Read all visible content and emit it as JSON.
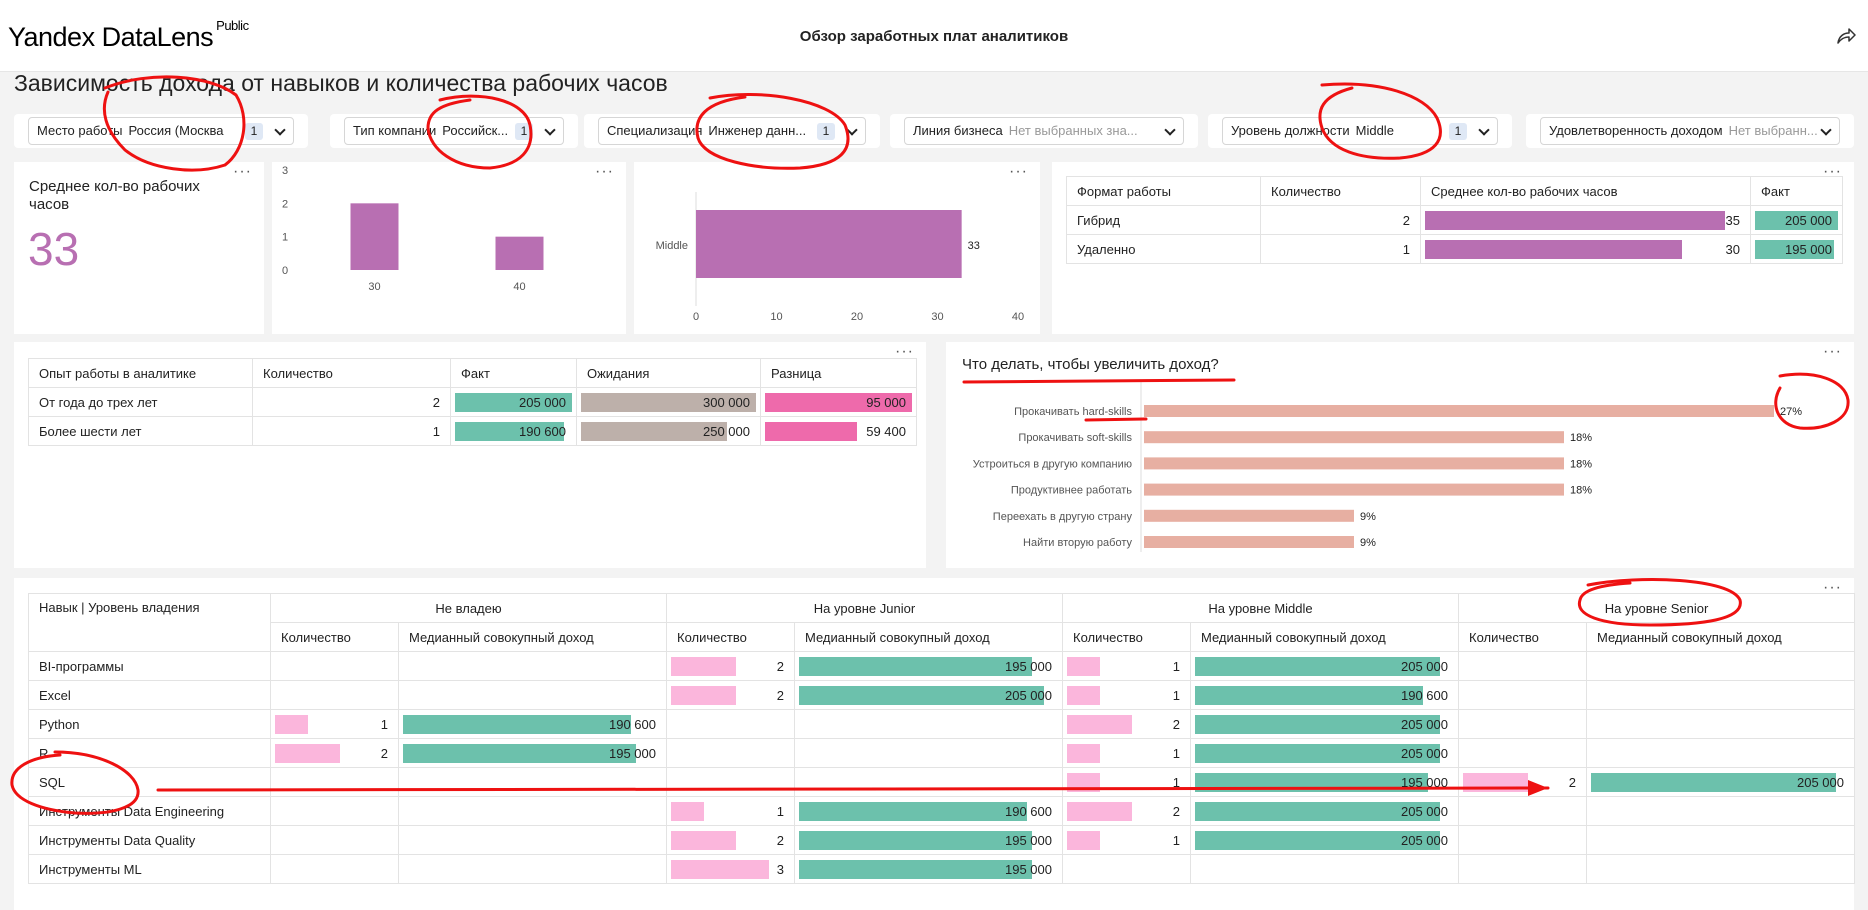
{
  "header": {
    "logo": "Yandex DataLens",
    "logo_badge": "Public",
    "dashboard_title": "Обзор заработных плат аналитиков"
  },
  "page_title": "Зависимость дохода от навыков и количества рабочих часов",
  "filters": [
    {
      "label": "Место работы",
      "value": "Россия (Москва",
      "count": "1",
      "placeholder": ""
    },
    {
      "label": "Тип компании",
      "value": "Российск...",
      "count": "1",
      "placeholder": ""
    },
    {
      "label": "Специализация",
      "value": "Инженер данн...",
      "count": "1",
      "placeholder": ""
    },
    {
      "label": "Линия бизнеса",
      "value": "",
      "count": "",
      "placeholder": "Нет выбранных зна..."
    },
    {
      "label": "Уровень должности",
      "value": "Middle",
      "count": "1",
      "placeholder": ""
    },
    {
      "label": "Удовлетворенность доходом",
      "value": "",
      "count": "",
      "placeholder": "Нет выбранн..."
    }
  ],
  "kpi": {
    "title": "Среднее кол-во рабочих часов",
    "value": "33"
  },
  "colors": {
    "purple": "#b86fb2",
    "teal": "#6cc1ac",
    "gray": "#bdb0aa",
    "magenta": "#ee6aab",
    "pink": "#fbb6dc",
    "salmon": "#e7afa2",
    "annotation": "#ee1111"
  },
  "chart_data": [
    {
      "type": "bar",
      "categories": [
        "30",
        "40"
      ],
      "values": [
        2,
        1
      ],
      "ylim": [
        0,
        3
      ],
      "yticks": [
        "0",
        "1",
        "2",
        "3"
      ]
    },
    {
      "type": "bar",
      "orientation": "horizontal",
      "categories": [
        "Middle"
      ],
      "values": [
        33
      ],
      "value_labels": [
        "33"
      ],
      "xlim": [
        0,
        40
      ],
      "xticks": [
        "0",
        "10",
        "20",
        "30",
        "40"
      ]
    },
    {
      "type": "bar",
      "orientation": "horizontal",
      "title": "Что делать, чтобы увеличить доход?",
      "categories": [
        "Прокачивать hard-skills",
        "Прокачивать soft-skills",
        "Устроиться в другую компанию",
        "Продуктивнее работать",
        "Переехать в другую страну",
        "Найти вторую работу"
      ],
      "values": [
        27,
        18,
        18,
        18,
        9,
        9
      ],
      "value_labels": [
        "27%",
        "18%",
        "18%",
        "18%",
        "9%",
        "9%"
      ]
    }
  ],
  "format_table": {
    "headers": [
      "Формат работы",
      "Количество",
      "Среднее кол-во рабочих часов",
      "Факт"
    ],
    "rows": [
      {
        "format": "Гибрид",
        "count": "2",
        "hours": "35",
        "hours_value": 35,
        "fact": "205 000",
        "fact_value": 205000
      },
      {
        "format": "Удаленно",
        "count": "1",
        "hours": "30",
        "hours_value": 30,
        "fact": "195 000",
        "fact_value": 195000
      }
    ]
  },
  "exp_table": {
    "headers": [
      "Опыт работы в аналитике",
      "Количество",
      "Факт",
      "Ожидания",
      "Разница"
    ],
    "rows": [
      {
        "exp": "От года до трех лет",
        "count": "2",
        "fact": "205 000",
        "fact_value": 205000,
        "expect": "300 000",
        "expect_value": 300000,
        "diff": "95 000",
        "diff_value": 95000
      },
      {
        "exp": "Более шести лет",
        "count": "1",
        "fact": "190 600",
        "fact_value": 190600,
        "expect": "250 000",
        "expect_value": 250000,
        "diff": "59 400",
        "diff_value": 59400
      }
    ]
  },
  "skills_table": {
    "header_first": "Навык | Уровень владения",
    "groups": [
      "Не владею",
      "На уровне Junior",
      "На уровне Middle",
      "На уровне Senior"
    ],
    "sub_headers": [
      "Количество",
      "Медианный совокупный доход"
    ],
    "rows": [
      {
        "skill": "BI-программы",
        "cells": [
          [
            "",
            ""
          ],
          [
            "2",
            "195 000"
          ],
          [
            "1",
            "205 000"
          ],
          [
            "",
            ""
          ]
        ],
        "vals": [
          [
            0,
            0
          ],
          [
            2,
            195000
          ],
          [
            1,
            205000
          ],
          [
            0,
            0
          ]
        ]
      },
      {
        "skill": "Excel",
        "cells": [
          [
            "",
            ""
          ],
          [
            "2",
            "205 000"
          ],
          [
            "1",
            "190 600"
          ],
          [
            "",
            ""
          ]
        ],
        "vals": [
          [
            0,
            0
          ],
          [
            2,
            205000
          ],
          [
            1,
            190600
          ],
          [
            0,
            0
          ]
        ]
      },
      {
        "skill": "Python",
        "cells": [
          [
            "1",
            "190 600"
          ],
          [
            "",
            ""
          ],
          [
            "2",
            "205 000"
          ],
          [
            "",
            ""
          ]
        ],
        "vals": [
          [
            1,
            190600
          ],
          [
            0,
            0
          ],
          [
            2,
            205000
          ],
          [
            0,
            0
          ]
        ]
      },
      {
        "skill": "R",
        "cells": [
          [
            "2",
            "195 000"
          ],
          [
            "",
            ""
          ],
          [
            "1",
            "205 000"
          ],
          [
            "",
            ""
          ]
        ],
        "vals": [
          [
            2,
            195000
          ],
          [
            0,
            0
          ],
          [
            1,
            205000
          ],
          [
            0,
            0
          ]
        ]
      },
      {
        "skill": "SQL",
        "cells": [
          [
            "",
            ""
          ],
          [
            "",
            ""
          ],
          [
            "1",
            "195 000"
          ],
          [
            "2",
            "205 000"
          ]
        ],
        "vals": [
          [
            0,
            0
          ],
          [
            0,
            0
          ],
          [
            1,
            195000
          ],
          [
            2,
            205000
          ]
        ]
      },
      {
        "skill": "Инструменты Data Engineering",
        "cells": [
          [
            "",
            ""
          ],
          [
            "1",
            "190 600"
          ],
          [
            "2",
            "205 000"
          ],
          [
            "",
            ""
          ]
        ],
        "vals": [
          [
            0,
            0
          ],
          [
            1,
            190600
          ],
          [
            2,
            205000
          ],
          [
            0,
            0
          ]
        ]
      },
      {
        "skill": "Инструменты Data Quality",
        "cells": [
          [
            "",
            ""
          ],
          [
            "2",
            "195 000"
          ],
          [
            "1",
            "205 000"
          ],
          [
            "",
            ""
          ]
        ],
        "vals": [
          [
            0,
            0
          ],
          [
            2,
            195000
          ],
          [
            1,
            205000
          ],
          [
            0,
            0
          ]
        ]
      },
      {
        "skill": "Инструменты ML",
        "cells": [
          [
            "",
            ""
          ],
          [
            "3",
            "195 000"
          ],
          [
            "",
            ""
          ],
          [
            "",
            ""
          ]
        ],
        "vals": [
          [
            0,
            0
          ],
          [
            3,
            195000
          ],
          [
            0,
            0
          ],
          [
            0,
            0
          ]
        ]
      }
    ]
  }
}
